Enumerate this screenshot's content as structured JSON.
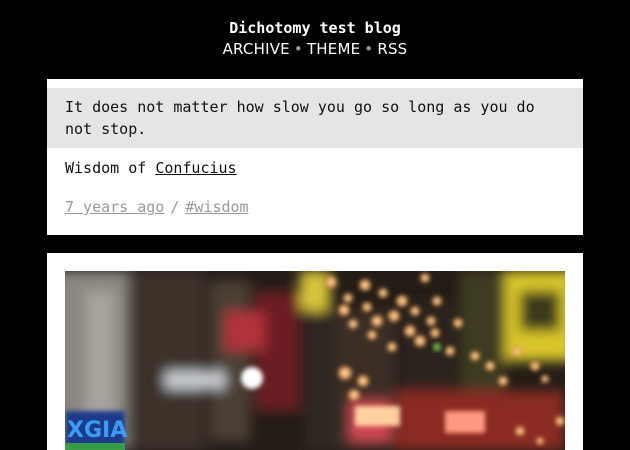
{
  "blog": {
    "title": "Dichotomy test blog"
  },
  "nav": {
    "items": [
      {
        "label": "ARCHIVE"
      },
      {
        "label": "THEME"
      },
      {
        "label": "RSS"
      }
    ],
    "separator": "•"
  },
  "quote_post": {
    "text": "It does not matter how slow you go so long as you do not stop.",
    "source_prefix": "Wisdom of",
    "source_link": "Confucius",
    "time_ago": "7 years ago",
    "meta_separator": "/",
    "tag": "#wisdom"
  },
  "photo_post": {
    "image_name": "city-lights-bokeh-photo",
    "sign_text": "XGIA"
  },
  "colors": {
    "background": "#000000",
    "card": "#ffffff",
    "quote_background": "#e5e5e5",
    "muted_text": "#9a9a9a"
  }
}
